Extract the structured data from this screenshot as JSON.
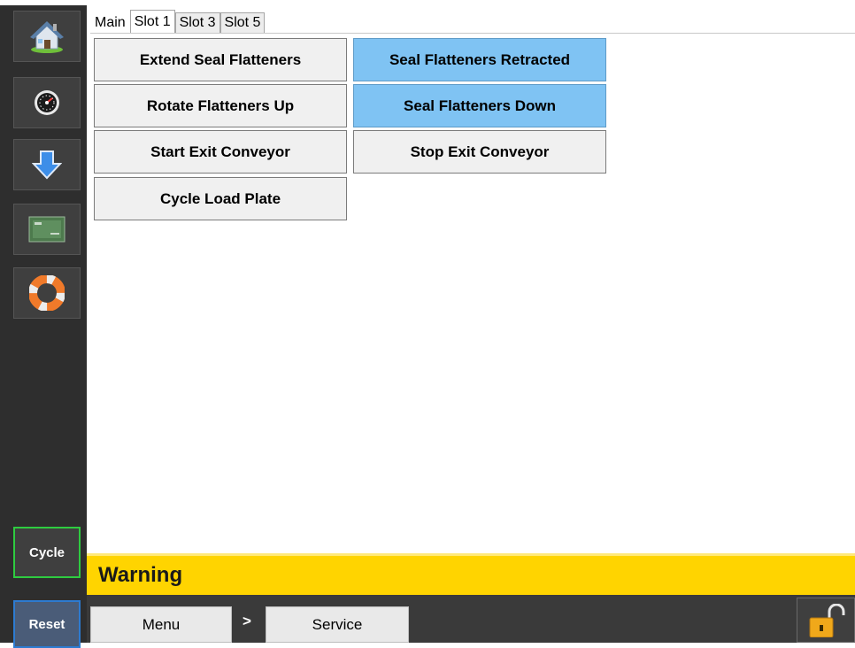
{
  "sidebar": {
    "items": [
      {
        "name": "home-icon"
      },
      {
        "name": "gauge-icon"
      },
      {
        "name": "download-arrow-icon"
      },
      {
        "name": "cpu-icon"
      },
      {
        "name": "lifebuoy-icon"
      }
    ],
    "cycle_label": "Cycle",
    "reset_label": "Reset"
  },
  "tabs": [
    {
      "label": "Main",
      "active": false
    },
    {
      "label": "Slot 1",
      "active": true
    },
    {
      "label": "Slot 3",
      "active": false
    },
    {
      "label": "Slot 5",
      "active": false
    }
  ],
  "controls": {
    "extend_seal_flatteners": "Extend Seal Flatteners",
    "seal_flatteners_retracted": "Seal Flatteners Retracted",
    "rotate_flatteners_up": "Rotate Flatteners Up",
    "seal_flatteners_down": "Seal Flatteners Down",
    "start_exit_conveyor": "Start Exit Conveyor",
    "stop_exit_conveyor": "Stop Exit Conveyor",
    "cycle_load_plate": "Cycle Load Plate"
  },
  "status": {
    "warning": "Warning"
  },
  "nav": {
    "menu_label": "Menu",
    "separator": ">",
    "service_label": "Service"
  },
  "colors": {
    "active_indicator": "#7fc3f3",
    "warning_bar": "#ffd400",
    "cycle_border": "#2ecc40",
    "reset_border": "#2d7bd1"
  }
}
